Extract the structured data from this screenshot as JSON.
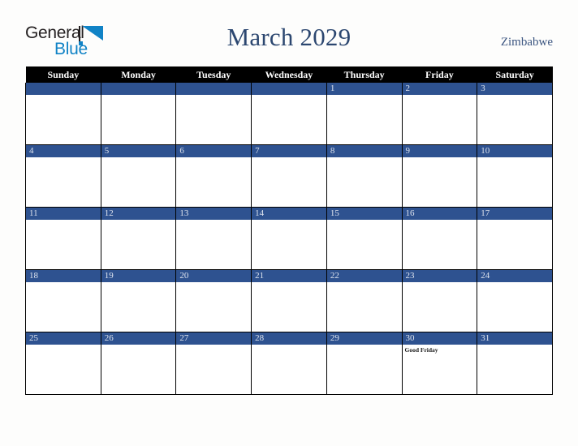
{
  "brand": {
    "name_part1": "General",
    "name_part2": "Blue",
    "logo_icon": "triangle-logo-icon",
    "colors": {
      "dark": "#231f20",
      "blue": "#1183c6"
    }
  },
  "header": {
    "title": "March 2029",
    "country": "Zimbabwe"
  },
  "colors": {
    "accent_blue": "#2e5290",
    "header_black": "#000000",
    "title_navy": "#2c4770",
    "page_background": "#fdfdfc",
    "daynum_text": "#dfe4ee"
  },
  "calendar": {
    "weekdays": [
      "Sunday",
      "Monday",
      "Tuesday",
      "Wednesday",
      "Thursday",
      "Friday",
      "Saturday"
    ],
    "weeks": [
      [
        {
          "day": "",
          "events": []
        },
        {
          "day": "",
          "events": []
        },
        {
          "day": "",
          "events": []
        },
        {
          "day": "",
          "events": []
        },
        {
          "day": "1",
          "events": []
        },
        {
          "day": "2",
          "events": []
        },
        {
          "day": "3",
          "events": []
        }
      ],
      [
        {
          "day": "4",
          "events": []
        },
        {
          "day": "5",
          "events": []
        },
        {
          "day": "6",
          "events": []
        },
        {
          "day": "7",
          "events": []
        },
        {
          "day": "8",
          "events": []
        },
        {
          "day": "9",
          "events": []
        },
        {
          "day": "10",
          "events": []
        }
      ],
      [
        {
          "day": "11",
          "events": []
        },
        {
          "day": "12",
          "events": []
        },
        {
          "day": "13",
          "events": []
        },
        {
          "day": "14",
          "events": []
        },
        {
          "day": "15",
          "events": []
        },
        {
          "day": "16",
          "events": []
        },
        {
          "day": "17",
          "events": []
        }
      ],
      [
        {
          "day": "18",
          "events": []
        },
        {
          "day": "19",
          "events": []
        },
        {
          "day": "20",
          "events": []
        },
        {
          "day": "21",
          "events": []
        },
        {
          "day": "22",
          "events": []
        },
        {
          "day": "23",
          "events": []
        },
        {
          "day": "24",
          "events": []
        }
      ],
      [
        {
          "day": "25",
          "events": []
        },
        {
          "day": "26",
          "events": []
        },
        {
          "day": "27",
          "events": []
        },
        {
          "day": "28",
          "events": []
        },
        {
          "day": "29",
          "events": []
        },
        {
          "day": "30",
          "events": [
            "Good Friday"
          ]
        },
        {
          "day": "31",
          "events": []
        }
      ]
    ]
  }
}
